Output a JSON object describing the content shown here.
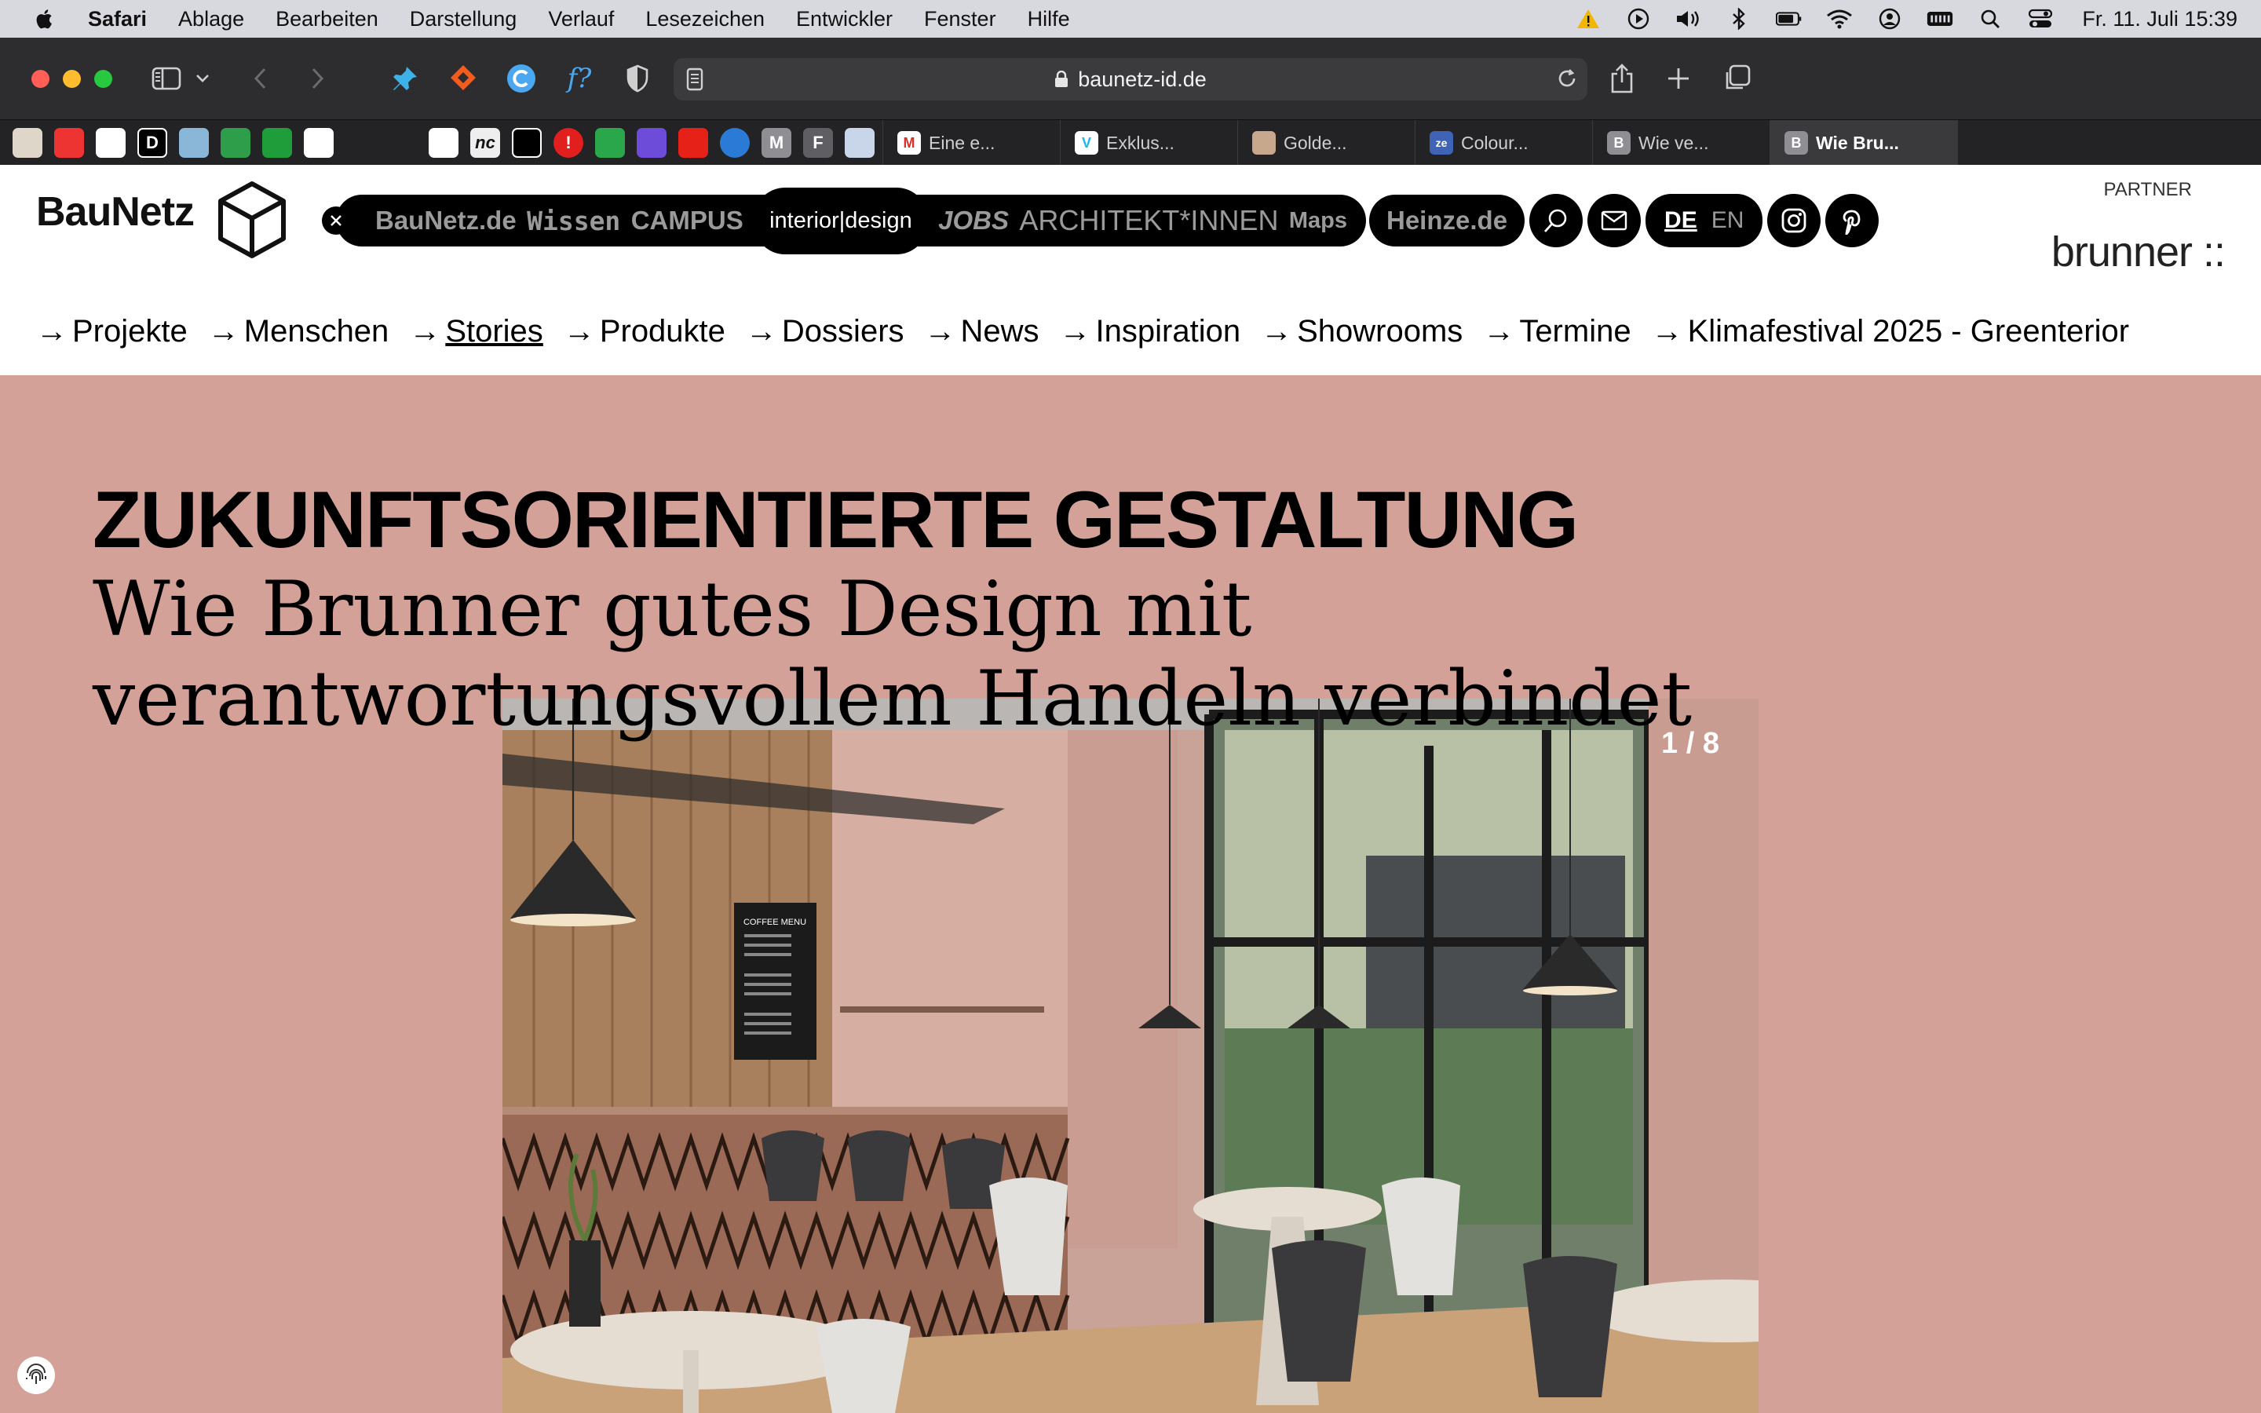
{
  "menubar": {
    "app": "Safari",
    "items": [
      "Ablage",
      "Bearbeiten",
      "Darstellung",
      "Verlauf",
      "Lesezeichen",
      "Entwickler",
      "Fenster",
      "Hilfe"
    ],
    "clock": "Fr. 11. Juli  15:39"
  },
  "toolbar": {
    "url": "baunetz-id.de"
  },
  "tabs": {
    "pinned": [
      "",
      "",
      "",
      "D",
      "",
      "",
      "",
      "",
      "",
      "",
      "",
      "nc",
      "",
      "!",
      "",
      "",
      "",
      "",
      "M",
      "F",
      ""
    ],
    "items": [
      {
        "label": "Eine e...",
        "favicon": "M"
      },
      {
        "label": "Exklus...",
        "favicon": "V"
      },
      {
        "label": "Golde...",
        "favicon": ""
      },
      {
        "label": "Colour...",
        "favicon": "ze"
      },
      {
        "label": "Wie ve...",
        "favicon": "B"
      },
      {
        "label": "Wie Bru...",
        "favicon": "B"
      }
    ]
  },
  "site": {
    "logo": "BauNetz",
    "network": [
      "BauNetz.de",
      "Wissen",
      "CAMPUS",
      "interior|design",
      "JOBS",
      "ARCHITEKT*INNEN",
      "Maps"
    ],
    "heinze": "Heinze.de",
    "lang": {
      "de": "DE",
      "en": "EN"
    },
    "partner_label": "PARTNER",
    "partner_logo": "brunner ::",
    "nav": [
      "Projekte",
      "Menschen",
      "Stories",
      "Produkte",
      "Dossiers",
      "News",
      "Inspiration",
      "Showrooms",
      "Termine",
      "Klimafestival 2025 - Greenterior"
    ],
    "nav_arrow": "→"
  },
  "hero": {
    "kicker": "ZUKUNFTSORIENTIERTE GESTALTUNG",
    "title": "Wie Brunner gutes Design mit verantwortungsvollem Handeln verbindet",
    "slide_counter": "1 / 8",
    "menu_board": "COFFEE MENU"
  },
  "colors": {
    "hero_bg": "#d4a198",
    "toolbar": "#2d2d2f",
    "tabbar": "#232325"
  }
}
